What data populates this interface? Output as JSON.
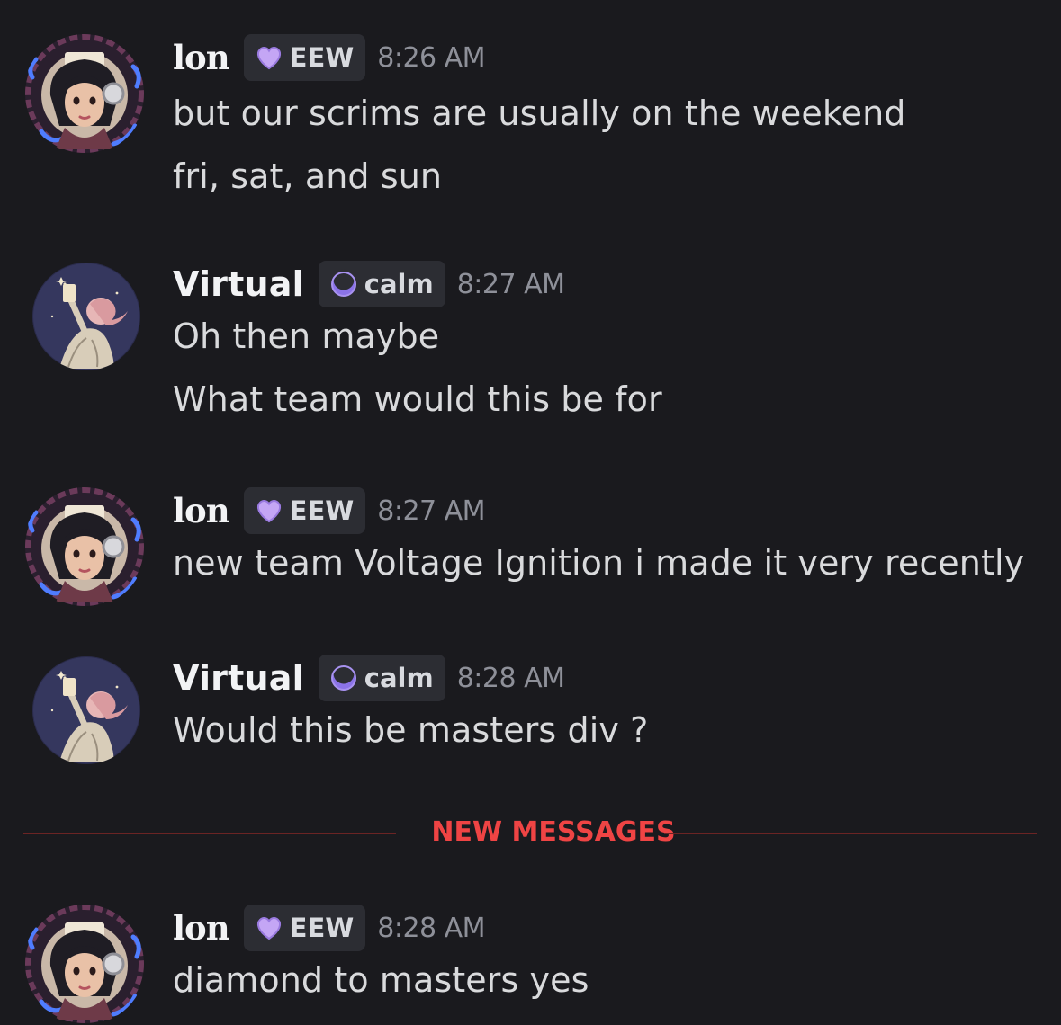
{
  "colors": {
    "background": "#1a1a1e",
    "username": "#f2f3f5",
    "message_text": "#d9dadc",
    "timestamp": "#8e9099",
    "tag_background": "#2c2d33",
    "new_messages": "#ef4444",
    "ion_tag_icon": "#c4a6f5",
    "virtual_tag_icon": "#8b73e8"
  },
  "messages": [
    {
      "username": "lon",
      "avatar": "ion-avatar",
      "tag": {
        "label": "EEW",
        "icon": "heart-icon"
      },
      "time": "8:26 AM",
      "lines": [
        "but our scrims are usually on the weekend",
        "fri, sat, and sun"
      ]
    },
    {
      "username": "Virtual",
      "avatar": "virtual-avatar",
      "tag": {
        "label": "calm",
        "icon": "moon-icon"
      },
      "time": "8:27 AM",
      "lines": [
        "Oh then maybe",
        "What team would this be for"
      ]
    },
    {
      "username": "lon",
      "avatar": "ion-avatar",
      "tag": {
        "label": "EEW",
        "icon": "heart-icon"
      },
      "time": "8:27 AM",
      "lines": [
        "new team Voltage Ignition i made it very recently"
      ]
    },
    {
      "username": "Virtual",
      "avatar": "virtual-avatar",
      "tag": {
        "label": "calm",
        "icon": "moon-icon"
      },
      "time": "8:28 AM",
      "lines": [
        "Would this be masters div ?"
      ]
    },
    {
      "username": "lon",
      "avatar": "ion-avatar",
      "tag": {
        "label": "EEW",
        "icon": "heart-icon"
      },
      "time": "8:28 AM",
      "lines": [
        "diamond to masters yes"
      ]
    }
  ],
  "divider": {
    "label": "NEW MESSAGES"
  }
}
